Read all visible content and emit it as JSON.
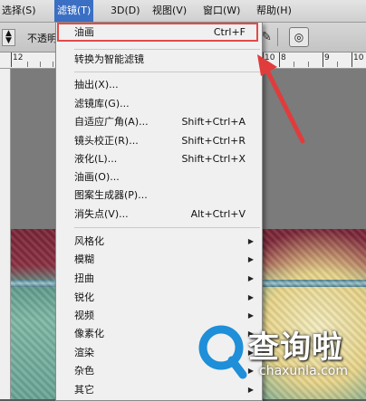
{
  "menubar": {
    "items": [
      "选择(S)",
      "滤镜(T)",
      "3D(D)",
      "视图(V)",
      "窗口(W)",
      "帮助(H)"
    ],
    "active_index": 1
  },
  "options_bar": {
    "label": "不透明"
  },
  "ruler": {
    "numbers": [
      "12",
      "10",
      "8",
      "9",
      "10"
    ]
  },
  "filter_menu": {
    "items": [
      {
        "label": "油画",
        "shortcut": "Ctrl+F",
        "highlighted": true
      },
      {
        "separator": true
      },
      {
        "label": "转换为智能滤镜"
      },
      {
        "separator": true
      },
      {
        "label": "抽出(X)..."
      },
      {
        "label": "滤镜库(G)..."
      },
      {
        "label": "自适应广角(A)...",
        "shortcut": "Shift+Ctrl+A"
      },
      {
        "label": "镜头校正(R)...",
        "shortcut": "Shift+Ctrl+R"
      },
      {
        "label": "液化(L)...",
        "shortcut": "Shift+Ctrl+X"
      },
      {
        "label": "油画(O)..."
      },
      {
        "label": "图案生成器(P)..."
      },
      {
        "label": "消失点(V)...",
        "shortcut": "Alt+Ctrl+V"
      },
      {
        "separator": true
      },
      {
        "label": "风格化",
        "submenu": true
      },
      {
        "label": "模糊",
        "submenu": true
      },
      {
        "label": "扭曲",
        "submenu": true
      },
      {
        "label": "锐化",
        "submenu": true
      },
      {
        "label": "视频",
        "submenu": true
      },
      {
        "label": "像素化",
        "submenu": true
      },
      {
        "label": "渲染",
        "submenu": true
      },
      {
        "label": "杂色",
        "submenu": true
      },
      {
        "label": "其它",
        "submenu": true
      }
    ]
  },
  "watermark": {
    "chinese": "查询啦",
    "domain": "chaxunla.com"
  },
  "colors": {
    "menu_active": "#3a6fc4",
    "highlight_box": "#e24a4a",
    "annotation_arrow": "#e03c3c"
  }
}
